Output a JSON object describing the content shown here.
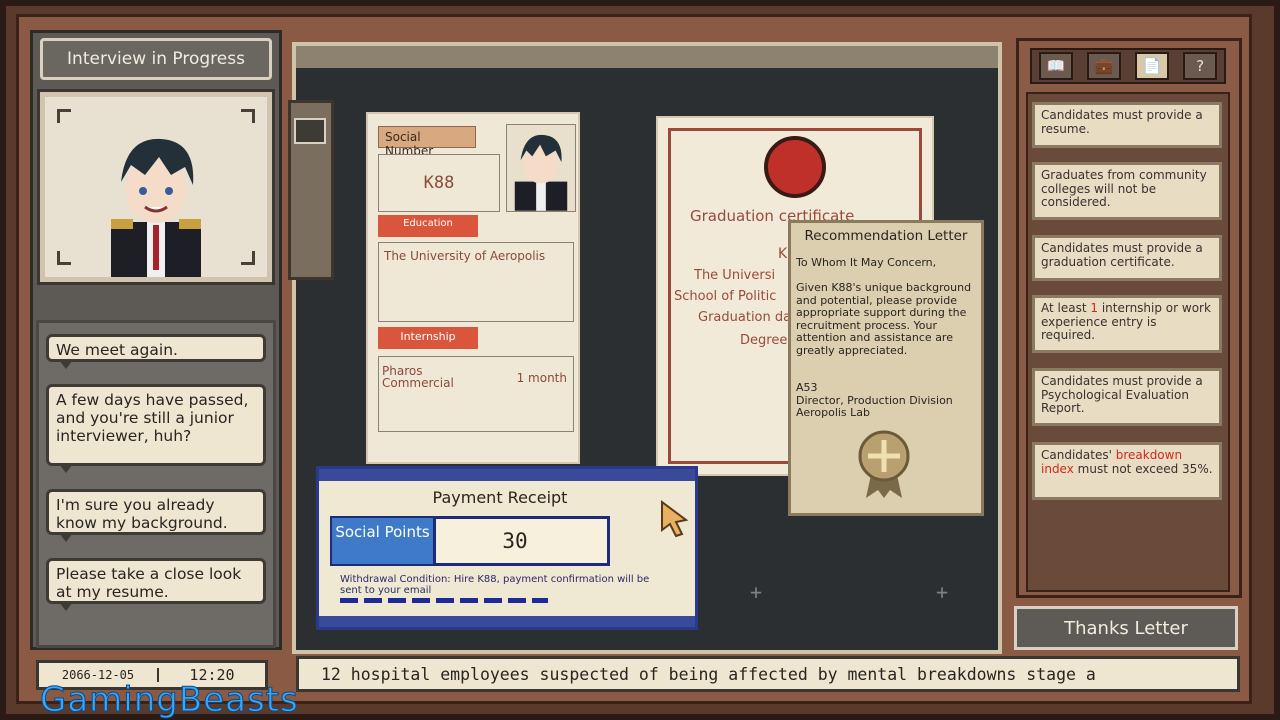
{
  "header": {
    "title": "Interview in Progress"
  },
  "chat": {
    "messages": [
      "We meet again.",
      "A few days have passed, and you're still a junior interviewer, huh?",
      "I'm sure you already know my background.",
      "Please take a close look at my resume."
    ]
  },
  "clock": {
    "date": "2066-12-05",
    "time": "12:20"
  },
  "resume": {
    "social_label": "Social Number",
    "social_value": "K88",
    "education_label": "Education",
    "education_value": "The University of Aeropolis",
    "internship_label": "Internship",
    "internship_company": "Pharos Commercial",
    "internship_duration": "1 month"
  },
  "certificate": {
    "title": "Graduation certificate",
    "name_partial": "K",
    "university_partial": "The Universi",
    "school_partial": "School of Politic",
    "date_partial": "Graduation da",
    "degree_partial": "Degree"
  },
  "recommendation": {
    "title": "Recommendation Letter",
    "salutation": "To Whom It May Concern,",
    "body": "Given K88's unique background and potential, please provide appropriate support during the recruitment process. Your attention and assistance are greatly appreciated.",
    "signer_id": "A53",
    "signer_title": "Director, Production Division",
    "signer_org": "Aeropolis Lab"
  },
  "receipt": {
    "title": "Payment Receipt",
    "label": "Social Points",
    "value": "30",
    "condition": "Withdrawal Condition: Hire K88, payment confirmation will be sent to your email"
  },
  "rules": [
    {
      "text": "Candidates must provide a resume."
    },
    {
      "text": "Graduates from community colleges will not be considered."
    },
    {
      "text": "Candidates must provide a graduation certificate."
    },
    {
      "pre": "At least ",
      "hl": "1",
      "post": " internship or work experience entry is required."
    },
    {
      "text": "Candidates must provide a Psychological Evaluation Report."
    },
    {
      "pre": "Candidates' ",
      "hl": "breakdown index",
      "post": " must not exceed 35%."
    }
  ],
  "tools": [
    "book-icon",
    "briefcase-icon",
    "document-icon",
    "help-icon"
  ],
  "tool_glyphs": [
    "📖",
    "💼",
    "📄",
    "?"
  ],
  "thanks_button": "Thanks Letter",
  "ticker": "12 hospital employees suspected of being affected by mental breakdowns stage a",
  "watermark": "GamingBeasts",
  "colors": {
    "accent_red": "#d9553c",
    "receipt_blue": "#2a3a8a",
    "highlight_red": "#d02a20"
  }
}
